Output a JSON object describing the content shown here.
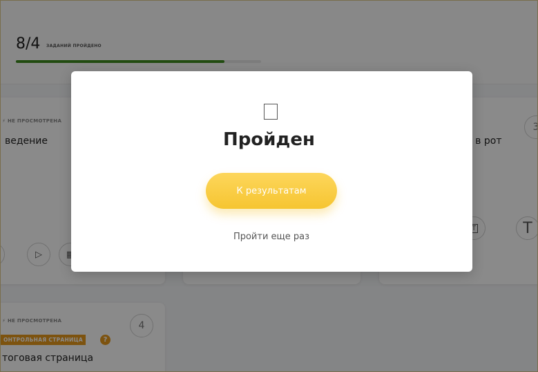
{
  "progress": {
    "count": "8/4",
    "label": "ЗАДАНИЙ ПРОЙДЕНО",
    "fraction": 0.85,
    "color": "#3d8b1f"
  },
  "cards": {
    "card1": {
      "status": "НЕ ПРОСМОТРЕНА",
      "title": "ведение"
    },
    "card3": {
      "title": "то в рот",
      "number": "3"
    },
    "card4": {
      "status": "НЕ ПРОСМОТРЕНА",
      "badge": "ОНТРОЛЬНАЯ СТРАНИЦА",
      "help": "?",
      "title": "тоговая страница",
      "number": "4"
    }
  },
  "icons": {
    "info": "i",
    "play": "▷",
    "text_box": "T",
    "text": "T"
  },
  "modal": {
    "title": "Пройден",
    "primary_button": "К результатам",
    "secondary_link": "Пройти еще раз",
    "accent": "#f6c531"
  }
}
